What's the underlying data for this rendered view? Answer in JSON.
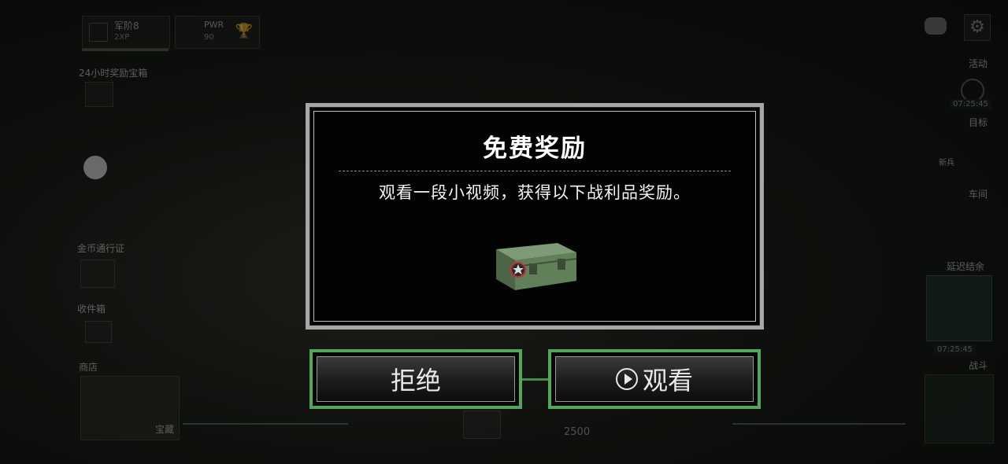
{
  "hud": {
    "rank_label": "军阶8",
    "rank_sub": "2XP",
    "pwr_label": "PWR",
    "pwr_value": "90",
    "chest_24h": "24小时奖励宝箱",
    "gold_pass": "金币通行证",
    "inbox": "收件箱",
    "shop": "商店",
    "shop_sub": "宝藏",
    "events": "活动",
    "events_timer": "07:25:45",
    "goals": "目标",
    "goals_sub": "新兵",
    "garage": "车间",
    "pass_sub": "延迟结余",
    "pass_timer": "07:25:45",
    "battle": "战斗",
    "bottom_value": "2500"
  },
  "modal": {
    "title": "免费奖励",
    "description": "观看一段小视频，获得以下战利品奖励。"
  },
  "buttons": {
    "reject_label": "拒绝",
    "watch_label": "观看"
  },
  "colors": {
    "button_border": "#55a55c",
    "modal_border": "#a6a8a6",
    "crate_green": "#5f7a58"
  }
}
